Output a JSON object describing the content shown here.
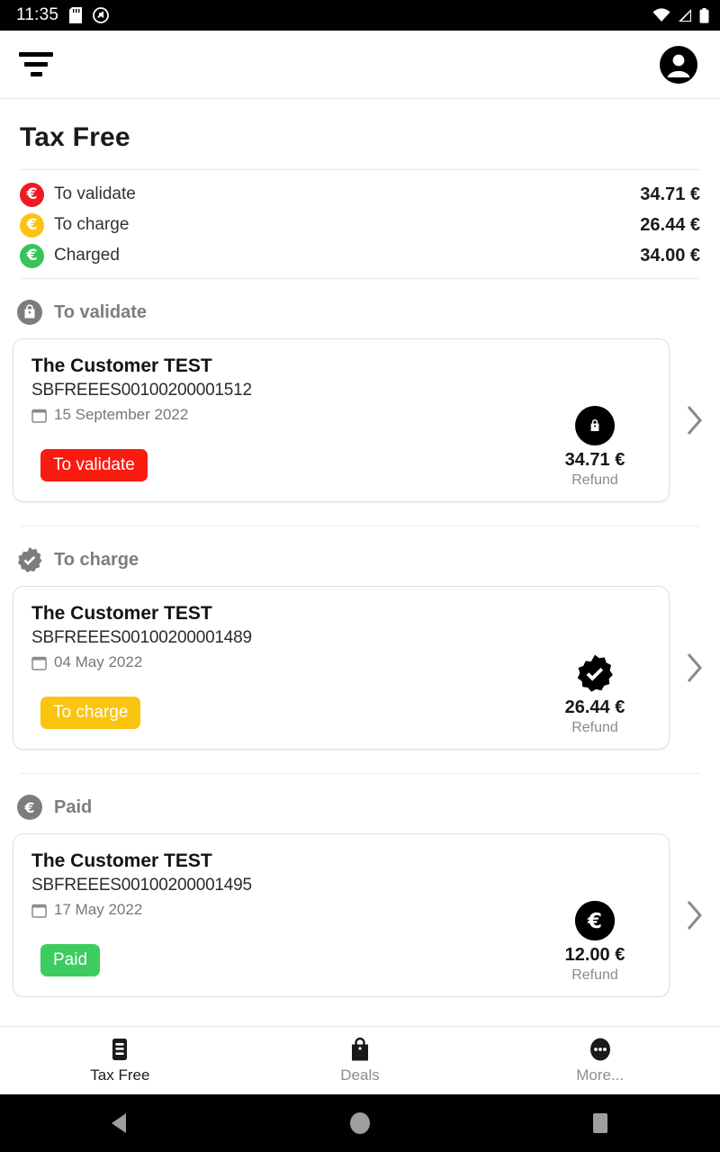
{
  "status_bar": {
    "time": "11:35",
    "icons": [
      "sd-card-icon",
      "mute-icon",
      "wifi-icon",
      "signal-icon",
      "battery-icon"
    ]
  },
  "app_bar": {
    "filter_icon": "filter-icon",
    "account_icon": "account-avatar-icon"
  },
  "page": {
    "title": "Tax Free"
  },
  "summary": {
    "rows": [
      {
        "label": "To validate",
        "amount": "34.71 €",
        "color": "#ED1C24",
        "icon": "euro-icon"
      },
      {
        "label": "To charge",
        "amount": "26.44 €",
        "color": "#FBC40F",
        "icon": "euro-icon"
      },
      {
        "label": "Charged",
        "amount": "34.00 €",
        "color": "#37C45A",
        "icon": "euro-icon"
      }
    ]
  },
  "sections": [
    {
      "header_label": "To validate",
      "header_icon": "shopping-bag-icon",
      "card": {
        "customer": "The Customer TEST",
        "reference": "SBFREEES00100200001512",
        "date": "15 September 2022",
        "date_icon": "calendar-icon",
        "status_label": "To validate",
        "status_color": "#F91B10",
        "amount": "34.71 €",
        "amount_caption": "Refund",
        "amount_icon": "shopping-bag-icon",
        "chevron_icon": "chevron-right-icon"
      }
    },
    {
      "header_label": "To charge",
      "header_icon": "verified-badge-icon",
      "card": {
        "customer": "The Customer TEST",
        "reference": "SBFREEES00100200001489",
        "date": "04 May 2022",
        "date_icon": "calendar-icon",
        "status_label": "To charge",
        "status_color": "#FBC40F",
        "amount": "26.44 €",
        "amount_caption": "Refund",
        "amount_icon": "verified-badge-icon",
        "chevron_icon": "chevron-right-icon"
      }
    },
    {
      "header_label": "Paid",
      "header_icon": "euro-circle-icon",
      "card": {
        "customer": "The Customer TEST",
        "reference": "SBFREEES00100200001495",
        "date": "17 May 2022",
        "date_icon": "calendar-icon",
        "status_label": "Paid",
        "status_color": "#3DCC5F",
        "amount": "12.00 €",
        "amount_caption": "Refund",
        "amount_icon": "euro-icon",
        "chevron_icon": "chevron-right-icon"
      }
    }
  ],
  "bottom_nav": {
    "items": [
      {
        "label": "Tax Free",
        "icon": "receipt-icon",
        "active": true
      },
      {
        "label": "Deals",
        "icon": "shopping-bag-icon",
        "active": false
      },
      {
        "label": "More...",
        "icon": "more-dots-icon",
        "active": false
      }
    ]
  },
  "system_nav": {
    "back": "back-triangle-icon",
    "home": "home-circle-icon",
    "recents": "recents-square-icon"
  }
}
